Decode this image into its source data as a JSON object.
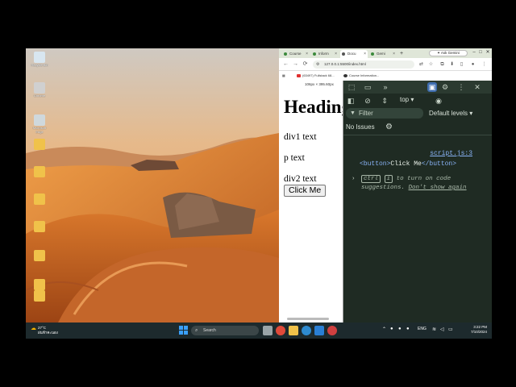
{
  "desktop": {
    "icons": [
      {
        "label": "Recycle Bin",
        "color": "#d8e6f0"
      },
      {
        "label": "Chrome",
        "color": "#d0d0d0"
      },
      {
        "label": "Microsoft Edge",
        "color": "#cfd8dc"
      },
      {
        "label": "",
        "color": "#f0c24a"
      },
      {
        "label": "",
        "color": "#f0c24a"
      },
      {
        "label": "",
        "color": "#f0c24a"
      },
      {
        "label": "",
        "color": "#f0c24a"
      },
      {
        "label": "",
        "color": "#f0c24a"
      },
      {
        "label": "",
        "color": "#f0c24a"
      },
      {
        "label": "",
        "color": "#f0c24a"
      }
    ]
  },
  "browser": {
    "tabs": [
      {
        "label": "Course",
        "active": false,
        "icon_color": "#3c8a3c"
      },
      {
        "label": "Inform",
        "active": false,
        "icon_color": "#3c8a3c"
      },
      {
        "label": "Docu",
        "active": true,
        "icon_color": "#555555"
      },
      {
        "label": "Gemi",
        "active": false,
        "icon_color": "#3c8a3c"
      }
    ],
    "new_tab": "+",
    "ask_gemini": "Ask Gemini",
    "window_controls": {
      "minimize": "–",
      "maximize": "□",
      "close": "✕"
    },
    "nav": {
      "back": "←",
      "forward": "→",
      "reload": "⟳"
    },
    "url": "127.0.0.1:5500/index.html",
    "bookmarks": [
      {
        "label": "(63497) Fullstack 68...",
        "color": "#e03030"
      },
      {
        "label": "Course Information...",
        "color": "#333333"
      }
    ]
  },
  "page": {
    "dimensions": "106px × 395.60px",
    "heading": "Heading",
    "div1": "div1 text",
    "p": "p text",
    "div2": "div2 text",
    "button": "Click Me"
  },
  "devtools": {
    "context": "top ▾",
    "filter_placeholder": "Filter",
    "levels": "Default levels ▾",
    "issues": "No Issues",
    "source_link": "script.js:3",
    "log": {
      "open_tag": "<button>",
      "text": "Click Me",
      "close_tag": "</button>"
    },
    "hint": {
      "ctrl": "ctrl",
      "i": "i",
      "middle": "to turn on code suggestions.",
      "dont_show": "Don't show again"
    }
  },
  "taskbar": {
    "weather_temp": "27°C",
    "weather_desc": "ฝนฟ้าคะนอง",
    "search": "Search",
    "lang": "ENG",
    "time": "3:22 PM",
    "date": "7/10/2024"
  }
}
